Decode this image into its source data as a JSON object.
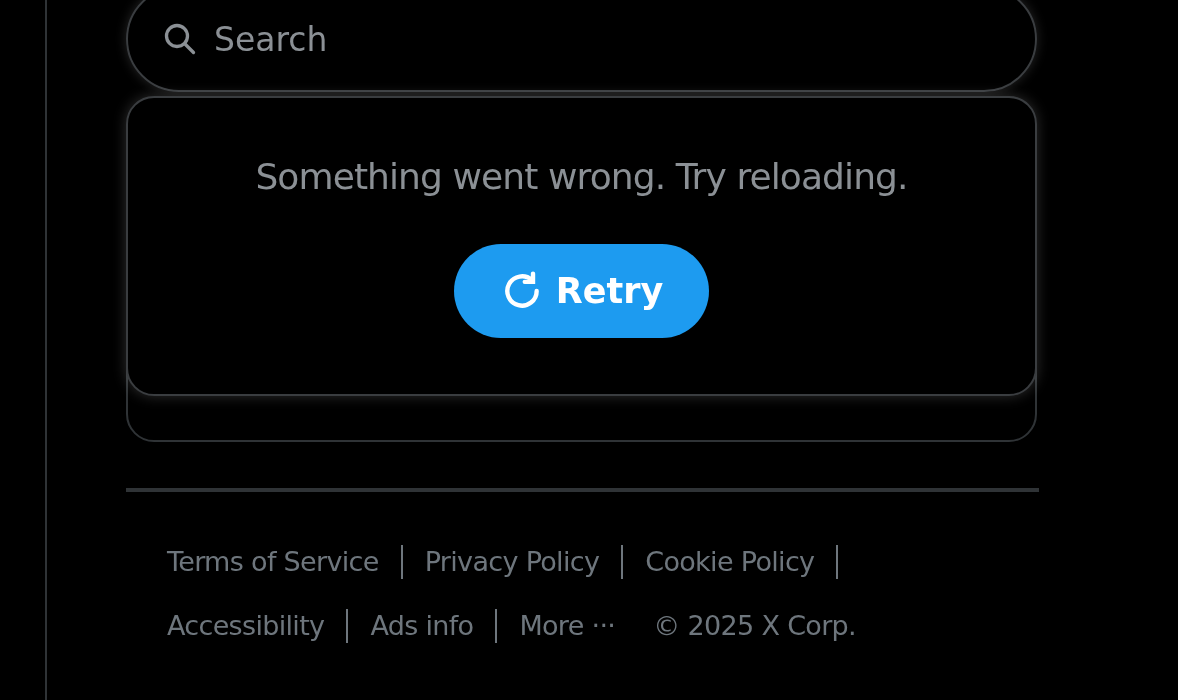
{
  "search": {
    "placeholder": "Search"
  },
  "error_card": {
    "message": "Something went wrong. Try reloading.",
    "button": "Retry"
  },
  "footer_rows": [
    [
      {
        "label": "Terms of Service",
        "separator": true
      },
      {
        "label": "Privacy Policy",
        "separator": true
      },
      {
        "label": "Cookie Policy",
        "separator": true
      }
    ],
    [
      {
        "label": "Accessibility",
        "separator": true
      },
      {
        "label": "Ads info",
        "separator": true
      },
      {
        "label": "More ···",
        "separator": false
      },
      {
        "label": "© 2025 X Corp.",
        "separator": false
      }
    ]
  ]
}
